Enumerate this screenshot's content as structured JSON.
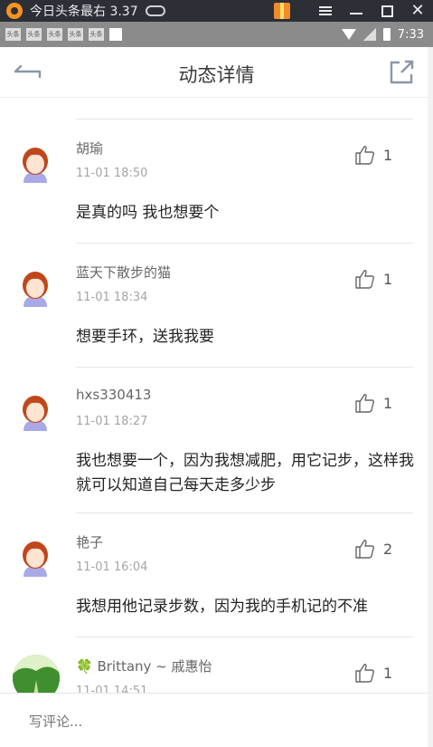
{
  "emulator": {
    "title": "今日头条最右 3.37"
  },
  "status_bar": {
    "notif_label": "头条",
    "time": "7:33"
  },
  "header": {
    "title": "动态详情"
  },
  "comments": [
    {
      "author": "胡瑜",
      "time": "11-01 18:50",
      "likes": "1",
      "text": "是真的吗   我也想要个"
    },
    {
      "author": "蓝天下散步的猫",
      "time": "11-01 18:34",
      "likes": "1",
      "text": "想要手环，送我我要"
    },
    {
      "author": "hxs330413",
      "time": "11-01 18:27",
      "likes": "1",
      "text": "我也想要一个，因为我想减肥，用它记步，这样我就可以知道自己每天走多少步"
    },
    {
      "author": "艳子",
      "time": "11-01 16:04",
      "likes": "2",
      "text": "我想用他记录步数，因为我的手机记的不准"
    },
    {
      "author": "🍀 Brittany ~ 戚惠怡",
      "time": "11-01 14:51",
      "likes": "1",
      "text": ""
    }
  ],
  "comment_bar": {
    "placeholder": "写评论..."
  },
  "colors": {
    "accent_icon": "#8a96a8",
    "avatar_hair": "#c0471b",
    "avatar_dress": "#a9a9e8"
  }
}
